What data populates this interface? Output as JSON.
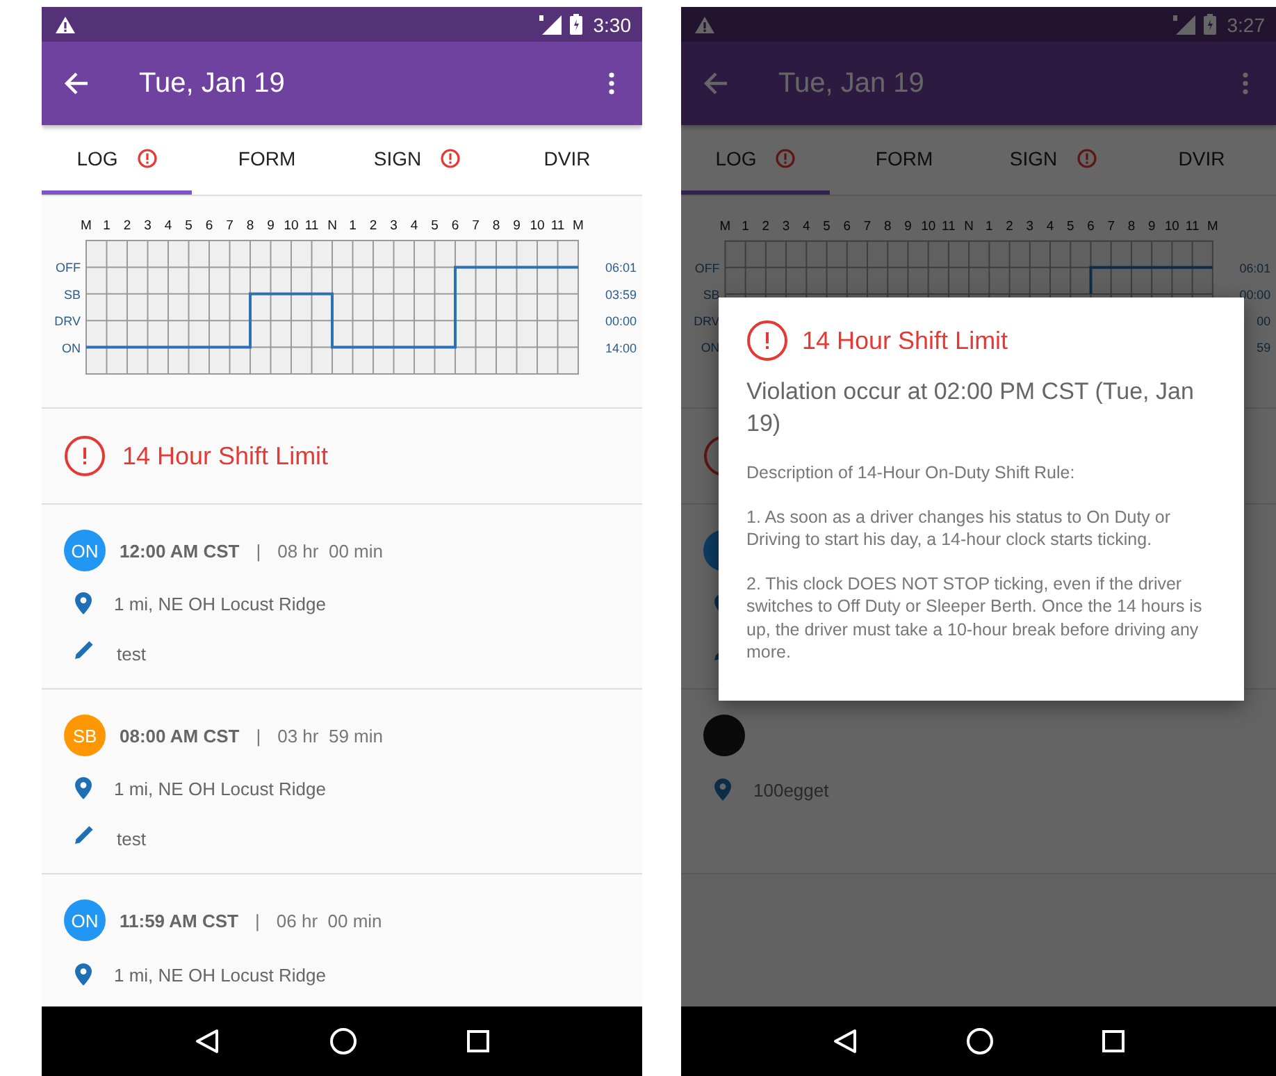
{
  "phones": [
    {
      "status_bar": {
        "time": "3:30"
      },
      "app_bar": {
        "title": "Tue, Jan 19"
      },
      "tabs": [
        {
          "label": "LOG",
          "alert": true,
          "selected": true
        },
        {
          "label": "FORM",
          "alert": false,
          "selected": false
        },
        {
          "label": "SIGN",
          "alert": true,
          "selected": false
        },
        {
          "label": "DVIR",
          "alert": false,
          "selected": false
        }
      ],
      "log_chart": {
        "totals": [
          "06:01",
          "03:59",
          "00:00",
          "14:00"
        ],
        "hour_labels": [
          "M",
          "1",
          "2",
          "3",
          "4",
          "5",
          "6",
          "7",
          "8",
          "9",
          "10",
          "11",
          "N",
          "1",
          "2",
          "3",
          "4",
          "5",
          "6",
          "7",
          "8",
          "9",
          "10",
          "11",
          "M"
        ],
        "status_labels": [
          "OFF",
          "SB",
          "DRV",
          "ON"
        ]
      },
      "violation": {
        "title": "14 Hour Shift Limit"
      },
      "entries": [
        {
          "status": "ON",
          "color": "#2196f3",
          "time": "12:00 AM CST",
          "separator": "|",
          "duration": "08 hr  00 min",
          "location": "1 mi, NE OH Locust Ridge",
          "note": "test"
        },
        {
          "status": "SB",
          "color": "#ff9800",
          "time": "08:00 AM CST",
          "separator": "|",
          "duration": "03 hr  59 min",
          "location": "1 mi, NE OH Locust Ridge",
          "note": "test"
        },
        {
          "status": "ON",
          "color": "#2196f3",
          "time": "11:59 AM CST",
          "separator": "|",
          "duration": "06 hr  00 min",
          "location": "1 mi, NE OH Locust Ridge"
        }
      ]
    },
    {
      "status_bar": {
        "time": "3:27"
      },
      "app_bar": {
        "title": "Tue, Jan 19"
      },
      "tabs": [
        {
          "label": "LOG",
          "alert": true,
          "selected": true
        },
        {
          "label": "FORM",
          "alert": false,
          "selected": false
        },
        {
          "label": "SIGN",
          "alert": true,
          "selected": false
        },
        {
          "label": "DVIR",
          "alert": false,
          "selected": false
        }
      ],
      "log_chart": {
        "totals": [
          "06:01",
          "00:00",
          "00",
          "59"
        ],
        "hour_labels": [
          "M",
          "1",
          "2",
          "3",
          "4",
          "5",
          "6",
          "7",
          "8",
          "9",
          "10",
          "11",
          "N",
          "1",
          "2",
          "3",
          "4",
          "5",
          "6",
          "7",
          "8",
          "9",
          "10",
          "11",
          "M"
        ],
        "status_labels": [
          "OFF",
          "SB",
          "DRV",
          "ON"
        ]
      },
      "entries": [
        {
          "color": "#0d3c61",
          "has_note": true
        },
        {
          "color": "#0a0a0a",
          "location": "100egget"
        }
      ],
      "dialog": {
        "title": "14 Hour Shift Limit",
        "violation_text": "Violation occur at 02:00 PM CST (Tue, Jan 19)",
        "paragraphs": [
          "Description of 14-Hour On-Duty Shift Rule:",
          "1. As soon as a driver changes his status to On Duty or Driving to start his day, a 14-hour clock starts ticking.",
          "2. This clock DOES NOT STOP ticking, even if the driver switches to Off Duty or Sleeper Berth. Once the 14 hours is up, the driver must take a 10-hour break before driving any more."
        ]
      }
    }
  ]
}
